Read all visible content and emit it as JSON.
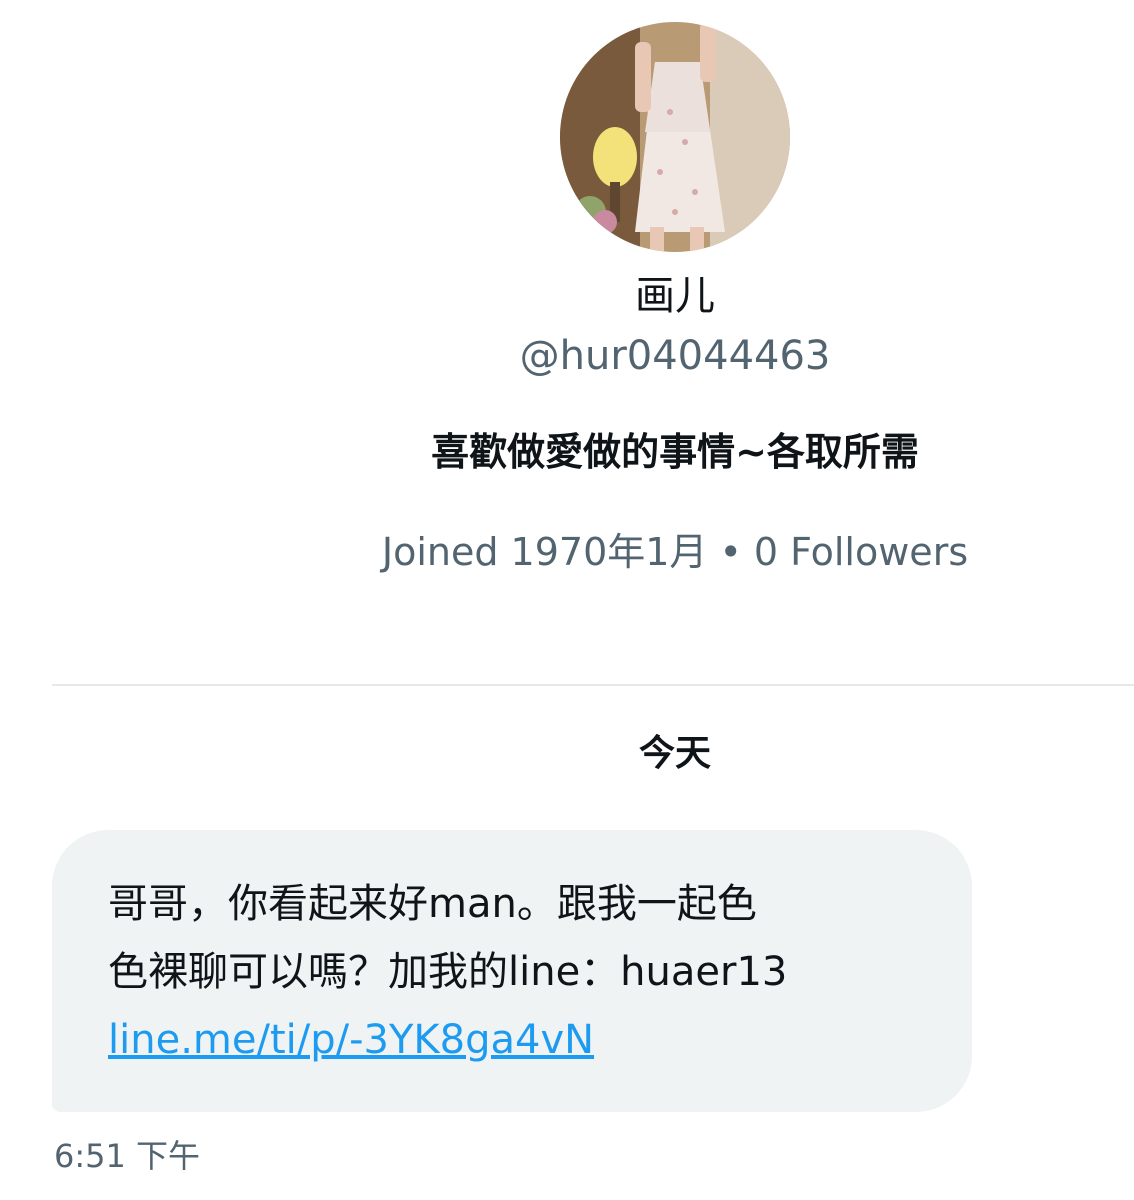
{
  "profile": {
    "display_name": "画儿",
    "handle": "@hur04044463",
    "bio": "喜歡做愛做的事情~各取所需",
    "joined": "Joined 1970年1月",
    "separator": "•",
    "followers": "0 Followers"
  },
  "conversation": {
    "day_label": "今天",
    "message": {
      "line1": "哥哥，你看起来好man。跟我一起色",
      "line2": "色裸聊可以嗎？加我的line：huaer13",
      "link": "line.me/ti/p/-3YK8ga4vN",
      "time": "6:51 下午"
    }
  },
  "colors": {
    "text_primary": "#0f1419",
    "text_secondary": "#536471",
    "link": "#1d9bf0",
    "bubble_bg": "#eff3f4",
    "divider": "#e6e9ec"
  }
}
